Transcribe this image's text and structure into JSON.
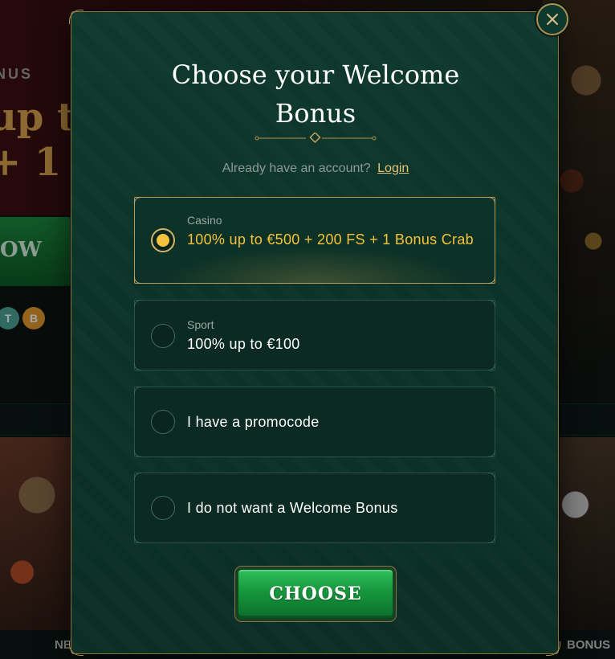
{
  "background": {
    "promo_label": "NUS",
    "promo_headline_line1": "up t",
    "promo_headline_line2": "+ 1",
    "cta_partial": "OW",
    "coins": [
      {
        "symbol": "T",
        "name": "tether-coin-icon"
      },
      {
        "symbol": "B",
        "name": "bitcoin-coin-icon"
      }
    ],
    "tab_left_partial": "NE",
    "tab_right_partial": "BONUS"
  },
  "modal": {
    "title": "Choose your Welcome Bonus",
    "account_prompt": "Already have an account?",
    "login_link": "Login",
    "options": [
      {
        "category": "Casino",
        "label": "100% up to €500 + 200 FS + 1 Bonus Crab",
        "selected": true
      },
      {
        "category": "Sport",
        "label": "100% up to €100",
        "selected": false
      },
      {
        "category": "",
        "label": "I have a promocode",
        "selected": false
      },
      {
        "category": "",
        "label": "I do not want a Welcome Bonus",
        "selected": false
      }
    ],
    "choose_button": "CHOOSE",
    "close_icon": "close-icon"
  },
  "colors": {
    "modal_bg": "#0d3529",
    "gold_border": "#b09050",
    "selected_text": "#f5c33b",
    "button_green": "#17963d",
    "link_gold": "#e3c27a"
  }
}
